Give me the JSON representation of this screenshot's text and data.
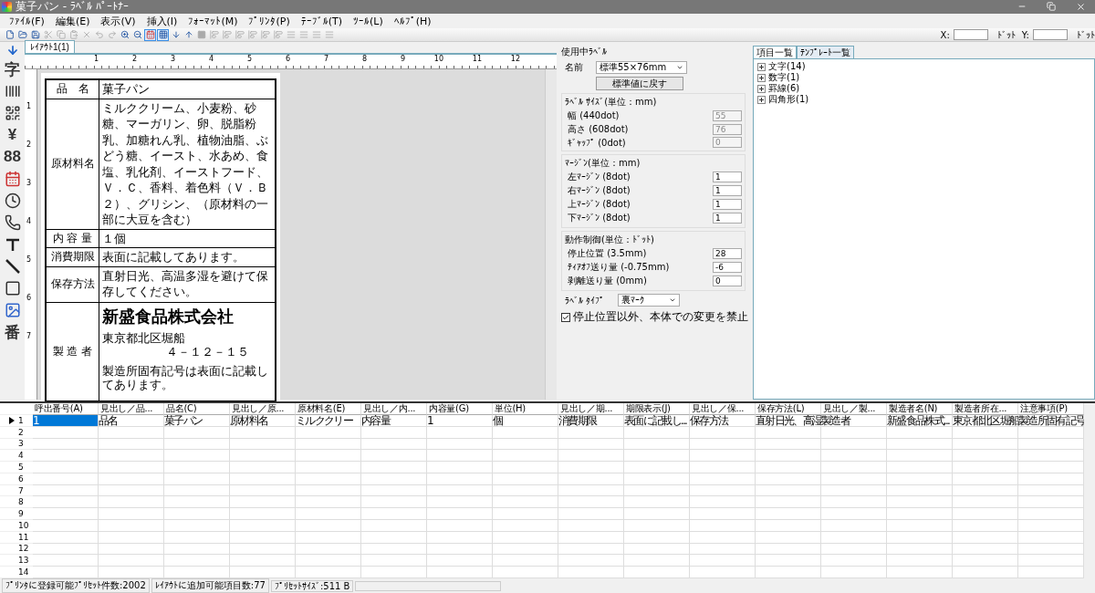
{
  "window": {
    "title": "菓子パン - ﾗﾍﾞﾙ ﾊﾟｰﾄﾅｰ"
  },
  "menu": [
    "ﾌｧｲﾙ(F)",
    "編集(E)",
    "表示(V)",
    "挿入(I)",
    "ﾌｫｰﾏｯﾄ(M)",
    "ﾌﾟﾘﾝﾀ(P)",
    "ﾃｰﾌﾞﾙ(T)",
    "ﾂｰﾙ(L)",
    "ﾍﾙﾌﾟ(H)"
  ],
  "toolbar": [
    {
      "kind": "new",
      "pressed": false,
      "disabled": false
    },
    {
      "kind": "open",
      "pressed": false,
      "disabled": false
    },
    {
      "kind": "save",
      "pressed": false,
      "disabled": false
    },
    {
      "kind": "cut",
      "pressed": false,
      "disabled": true
    },
    {
      "kind": "copy",
      "pressed": false,
      "disabled": true
    },
    {
      "kind": "paste",
      "pressed": false,
      "disabled": true
    },
    {
      "kind": "delete",
      "pressed": false,
      "disabled": true
    },
    {
      "kind": "undo",
      "pressed": false,
      "disabled": true
    },
    {
      "kind": "redo",
      "pressed": false,
      "disabled": true
    },
    {
      "kind": "zoomin",
      "pressed": false,
      "disabled": false
    },
    {
      "kind": "zoomout",
      "pressed": false,
      "disabled": false
    },
    {
      "kind": "calendar",
      "pressed": true,
      "disabled": false
    },
    {
      "kind": "grid",
      "pressed": true,
      "disabled": false
    },
    {
      "kind": "down",
      "pressed": false,
      "disabled": false
    },
    {
      "kind": "up",
      "pressed": false,
      "disabled": false
    },
    {
      "kind": "stop",
      "pressed": false,
      "disabled": true
    },
    {
      "kind": "align",
      "pressed": false,
      "disabled": true
    },
    {
      "kind": "align",
      "pressed": false,
      "disabled": true
    },
    {
      "kind": "align",
      "pressed": false,
      "disabled": true
    },
    {
      "kind": "align",
      "pressed": false,
      "disabled": true
    },
    {
      "kind": "align",
      "pressed": false,
      "disabled": true
    },
    {
      "kind": "align",
      "pressed": false,
      "disabled": true
    },
    {
      "kind": "lines",
      "pressed": false,
      "disabled": true
    },
    {
      "kind": "lines",
      "pressed": false,
      "disabled": true
    },
    {
      "kind": "lines",
      "pressed": false,
      "disabled": true
    },
    {
      "kind": "lines",
      "pressed": false,
      "disabled": true
    }
  ],
  "coords": [
    {
      "label": "X:",
      "unit": "ﾄﾞｯﾄ"
    },
    {
      "label": "Y:",
      "unit": "ﾄﾞｯﾄ"
    }
  ],
  "tools": [
    {
      "kind": "glyph",
      "text": "字"
    },
    {
      "kind": "barcode"
    },
    {
      "kind": "qr"
    },
    {
      "kind": "glyph",
      "text": "¥"
    },
    {
      "kind": "glyph",
      "text": "88"
    },
    {
      "kind": "calendar"
    },
    {
      "kind": "clock"
    },
    {
      "kind": "phone"
    },
    {
      "kind": "hline"
    },
    {
      "kind": "diagonal"
    },
    {
      "kind": "rect"
    },
    {
      "kind": "image"
    },
    {
      "kind": "glyph",
      "text": "番"
    }
  ],
  "layout_tab": "ﾚｲｱｳﾄ1(1)",
  "ruler": {
    "h": [
      "1",
      "2",
      "3",
      "4",
      "5",
      "6",
      "7",
      "8",
      "9",
      "10",
      "11",
      "12"
    ],
    "v": [
      "1",
      "2",
      "3",
      "4",
      "5",
      "6",
      "7"
    ]
  },
  "label": [
    {
      "head": "品　名",
      "kind": "text",
      "lines": [
        "菓子パン"
      ]
    },
    {
      "head": "原材料名",
      "kind": "text",
      "lines": [
        "ミルククリーム、小麦粉、砂糖、マーガリン、卵、脱脂粉乳、加糖れん乳、植物油脂、ぶどう糖、イースト、水あめ、食塩、乳化剤、イーストフード、Ｖ．Ｃ、香料、着色料（Ｖ．Ｂ２）、グリシン、（原材料の一部に大豆を含む）"
      ]
    },
    {
      "head": "内 容 量",
      "kind": "text",
      "lines": [
        "１個"
      ]
    },
    {
      "head": "消費期限",
      "kind": "text",
      "lines": [
        "表面に記載してあります。"
      ]
    },
    {
      "head": "保存方法",
      "kind": "text",
      "lines": [
        "直射日光、高温多湿を避けて保存してください。"
      ]
    },
    {
      "head": "製 造 者",
      "kind": "maker",
      "lines": [
        "新盛食品株式会社",
        "東京都北区堀船",
        "４－１２－１５",
        "製造所固有記号は表面に記載してあります。"
      ]
    }
  ],
  "settings": {
    "title": "使用中ﾗﾍﾞﾙ",
    "name_label": "名前",
    "name_value": "標準55×76mm",
    "reset_button": "標準値に戻す",
    "groups": [
      {
        "title": "ﾗﾍﾞﾙ ｻｲｽﾞ(単位：mm)",
        "fields": [
          {
            "label": "幅 (440dot)",
            "value": "55",
            "disabled": true
          },
          {
            "label": "高さ (608dot)",
            "value": "76",
            "disabled": true
          },
          {
            "label": "ｷﾞｬｯﾌﾟ (0dot)",
            "value": "0",
            "disabled": true
          }
        ]
      },
      {
        "title": "ﾏｰｼﾞﾝ(単位：mm)",
        "fields": [
          {
            "label": "左ﾏｰｼﾞﾝ (8dot)",
            "value": "1",
            "disabled": false
          },
          {
            "label": "右ﾏｰｼﾞﾝ (8dot)",
            "value": "1",
            "disabled": false
          },
          {
            "label": "上ﾏｰｼﾞﾝ (8dot)",
            "value": "1",
            "disabled": false
          },
          {
            "label": "下ﾏｰｼﾞﾝ (8dot)",
            "value": "1",
            "disabled": false
          }
        ]
      },
      {
        "title": "動作制御(単位：ﾄﾞｯﾄ)",
        "fields": [
          {
            "label": "停止位置 (3.5mm)",
            "value": "28",
            "disabled": false
          },
          {
            "label": "ﾃｨｱｵﾌ送り量 (-0.75mm)",
            "value": "-6",
            "disabled": false
          },
          {
            "label": "剥離送り量 (0mm)",
            "value": "0",
            "disabled": false
          }
        ]
      }
    ],
    "type_label": "ﾗﾍﾞﾙ ﾀｲﾌﾟ",
    "type_value": "裏ﾏｰｸ",
    "lock": {
      "label": "停止位置以外、本体での変更を禁止",
      "checked": true
    }
  },
  "tree_tabs": [
    {
      "label": "項目一覧",
      "selected": true
    },
    {
      "label": "ﾃﾝﾌﾟﾚｰﾄ一覧",
      "selected": false
    }
  ],
  "tree": [
    {
      "label": "文字(14)",
      "expanded": false
    },
    {
      "label": "数字(1)",
      "expanded": false
    },
    {
      "label": "罫線(6)",
      "expanded": false
    },
    {
      "label": "四角形(1)",
      "expanded": false
    }
  ],
  "grid": {
    "columns": [
      "呼出番号(A)",
      "見出し／品...",
      "品名(C)",
      "見出し／原...",
      "原材料名(E)",
      "見出し／内...",
      "内容量(G)",
      "単位(H)",
      "見出し／期...",
      "期限表示(J)",
      "見出し／保...",
      "保存方法(L)",
      "見出し／製...",
      "製造者名(N)",
      "製造者所在...",
      "注意事項(P)"
    ],
    "rows": [
      {
        "number": "1",
        "current": true,
        "cells": [
          {
            "text": "1",
            "selected": true
          },
          {
            "text": "品名",
            "selected": false
          },
          {
            "text": "菓子パン",
            "selected": false
          },
          {
            "text": "原材料名",
            "selected": false
          },
          {
            "text": "ミルククリー",
            "selected": false
          },
          {
            "text": "内容量",
            "selected": false
          },
          {
            "text": "1",
            "selected": false
          },
          {
            "text": "個",
            "selected": false
          },
          {
            "text": "消費期限",
            "selected": false
          },
          {
            "text": "表面に記載し...",
            "selected": false
          },
          {
            "text": "保存方法",
            "selected": false
          },
          {
            "text": "直射日光、高湿",
            "selected": false
          },
          {
            "text": "製造者",
            "selected": false
          },
          {
            "text": "新盛食品株式...",
            "selected": false
          },
          {
            "text": "東京都北区堀船",
            "selected": false
          },
          {
            "text": "製造所固有記号",
            "selected": false
          }
        ]
      },
      {
        "number": "2",
        "current": false
      },
      {
        "number": "3",
        "current": false
      },
      {
        "number": "4",
        "current": false
      },
      {
        "number": "5",
        "current": false
      },
      {
        "number": "6",
        "current": false
      },
      {
        "number": "7",
        "current": false
      },
      {
        "number": "8",
        "current": false
      },
      {
        "number": "9",
        "current": false
      },
      {
        "number": "10",
        "current": false
      },
      {
        "number": "11",
        "current": false
      },
      {
        "number": "12",
        "current": false
      },
      {
        "number": "13",
        "current": false
      },
      {
        "number": "14",
        "current": false
      }
    ]
  },
  "status": [
    "ﾌﾟﾘﾝﾀに登録可能ﾌﾟﾘｾｯﾄ件数:2002",
    "ﾚｲｱｳﾄに追加可能項目数:77",
    "ﾌﾟﾘｾｯﾄｻｲｽﾞ:511 B"
  ]
}
